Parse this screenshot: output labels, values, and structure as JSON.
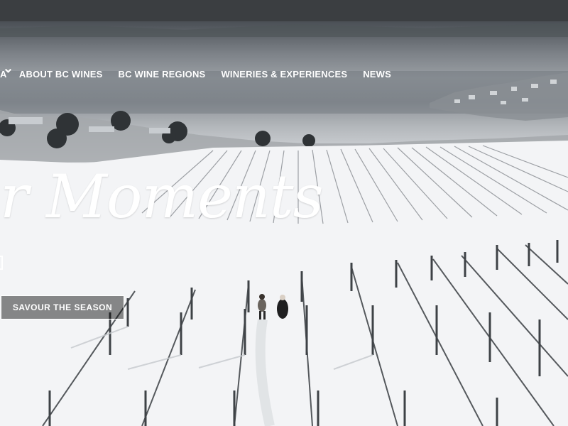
{
  "header": {
    "brand_fragment": "A"
  },
  "nav": {
    "items": [
      {
        "label": "ABOUT BC WINES",
        "icon": "chevron-down-icon"
      },
      {
        "label": "BC WINE REGIONS",
        "icon": "chevron-down-icon"
      },
      {
        "label": "WINERIES & EXPERIENCES",
        "icon": "chevron-down-icon"
      },
      {
        "label": "NEWS",
        "icon": "chevron-down-icon"
      }
    ]
  },
  "hero": {
    "headline": "r Moments",
    "cta_label": "SAVOUR THE SEASON"
  },
  "colors": {
    "nav_text": "#ffffff",
    "topbar": "#3b3e41",
    "cta_border": "#ffffff",
    "cta_background": "rgba(0,0,0,0.45)"
  }
}
